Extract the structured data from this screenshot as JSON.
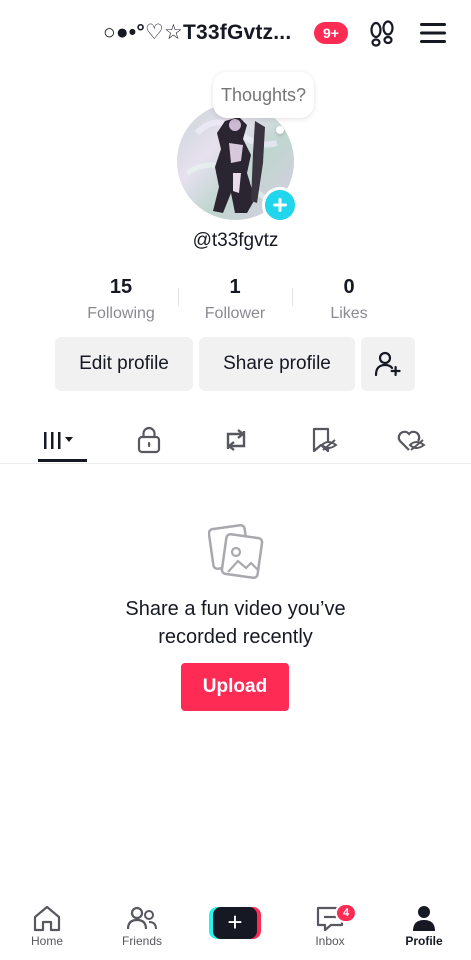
{
  "header": {
    "username": "○●•°♡☆T33fGvtz...",
    "notification_badge": "9+"
  },
  "profile": {
    "bubble_text": "Thoughts?",
    "handle": "@t33fgvtz",
    "stats": [
      {
        "value": "15",
        "label": "Following"
      },
      {
        "value": "1",
        "label": "Follower"
      },
      {
        "value": "0",
        "label": "Likes"
      }
    ],
    "edit_button": "Edit profile",
    "share_button": "Share profile"
  },
  "tabs": [
    "videos-grid-icon",
    "lock-icon",
    "repost-icon",
    "favorites-icon",
    "liked-icon"
  ],
  "empty_state": {
    "title_line1": "Share a fun video you’ve",
    "title_line2": "recorded recently",
    "upload_button": "Upload"
  },
  "nav": {
    "home": "Home",
    "friends": "Friends",
    "create": "+",
    "inbox": "Inbox",
    "inbox_badge": "4",
    "profile": "Profile"
  },
  "colors": {
    "accent": "#fe2c55",
    "cyan": "#20d5ec",
    "text": "#161823",
    "secondary_text": "#8a8b91",
    "button_bg": "#f1f1f2"
  }
}
